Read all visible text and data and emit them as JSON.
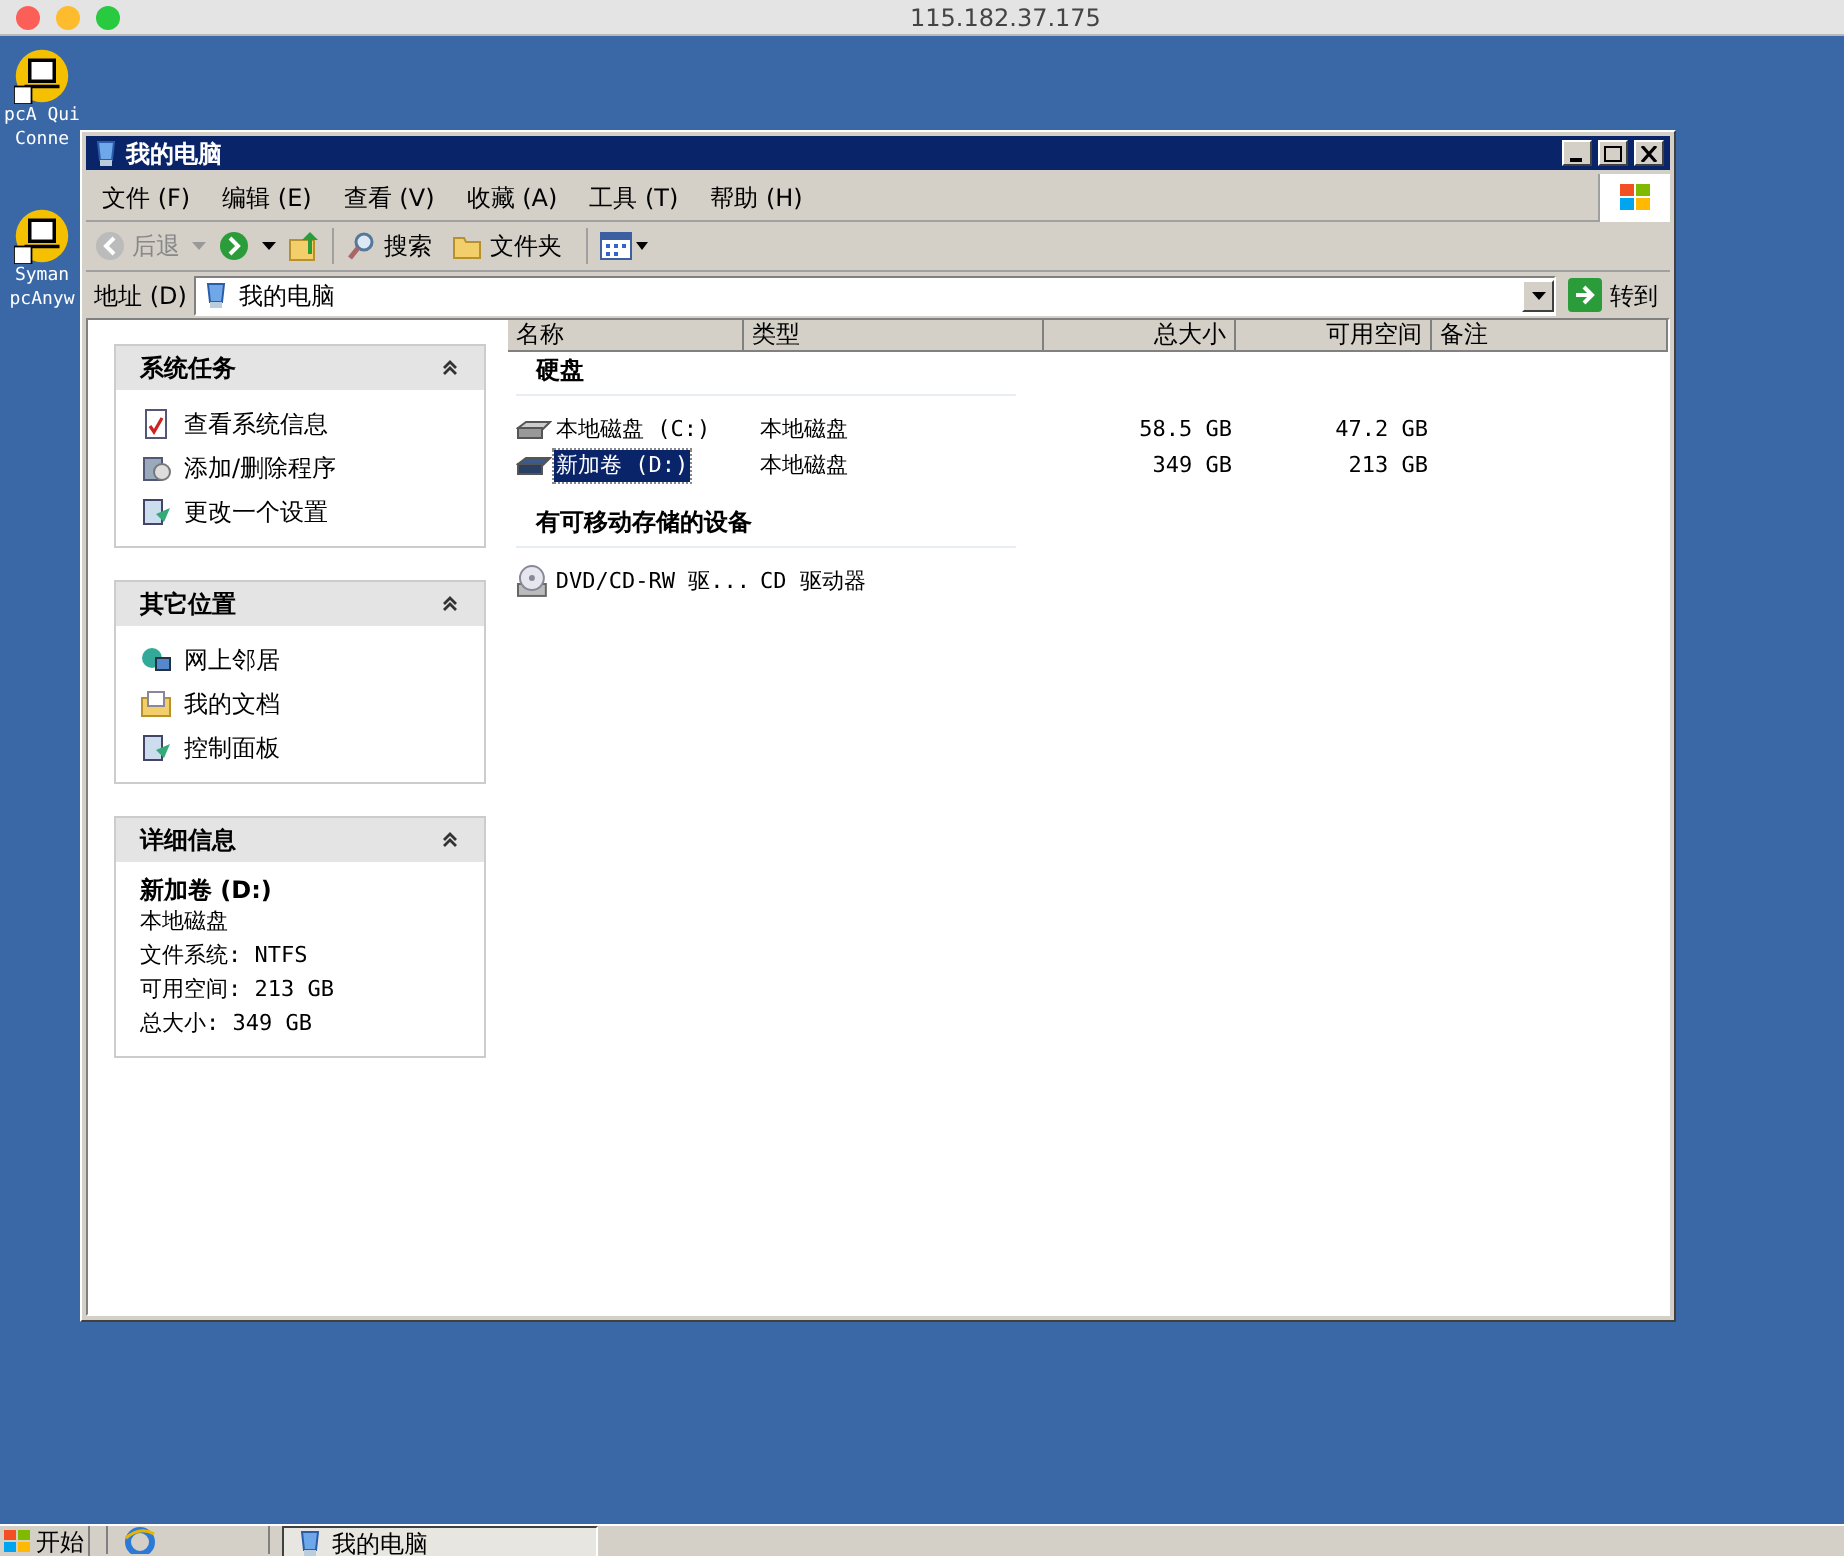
{
  "mac_titlebar": {
    "title": "115.182.37.175"
  },
  "desktop_icons": [
    {
      "lines": [
        "pcA Qui",
        "Conne"
      ]
    },
    {
      "lines": [
        "Syman",
        "pcAnyw"
      ]
    }
  ],
  "window": {
    "title": "我的电脑"
  },
  "menu": [
    "文件 (F)",
    "编辑 (E)",
    "查看 (V)",
    "收藏 (A)",
    "工具 (T)",
    "帮助 (H)"
  ],
  "toolbar": {
    "back": "后退",
    "search": "搜索",
    "folders": "文件夹"
  },
  "address": {
    "label": "地址 (D)",
    "value": "我的电脑",
    "go": "转到"
  },
  "panels": [
    {
      "kind": "links",
      "title": "系统任务",
      "expanded": true,
      "items": [
        "查看系统信息",
        "添加/删除程序",
        "更改一个设置"
      ]
    },
    {
      "kind": "links",
      "title": "其它位置",
      "expanded": true,
      "items": [
        "网上邻居",
        "我的文档",
        "控制面板"
      ]
    },
    {
      "kind": "details",
      "title": "详细信息",
      "expanded": true,
      "name": "新加卷 (D:)",
      "items": [
        "本地磁盘",
        "文件系统: NTFS",
        "可用空间: 213 GB",
        "总大小: 349 GB"
      ]
    }
  ],
  "columns": [
    "名称",
    "类型",
    "总大小",
    "可用空间",
    "备注"
  ],
  "groups": [
    {
      "title": "硬盘",
      "rows": [
        {
          "kind": "disk",
          "name": "本地磁盘 (C:)",
          "type": "本地磁盘",
          "total": "58.5 GB",
          "free": "47.2 GB",
          "selected": false
        },
        {
          "kind": "disk",
          "name": "新加卷 (D:)",
          "type": "本地磁盘",
          "total": "349 GB",
          "free": "213 GB",
          "selected": true
        }
      ]
    },
    {
      "title": "有可移动存储的设备",
      "rows": [
        {
          "kind": "cd",
          "name": "DVD/CD-RW 驱...",
          "type": "CD 驱动器",
          "selected": false
        }
      ]
    }
  ],
  "taskbar": {
    "start": "开始",
    "tasks": [
      {
        "label": "我的电脑",
        "selected": true
      }
    ]
  }
}
